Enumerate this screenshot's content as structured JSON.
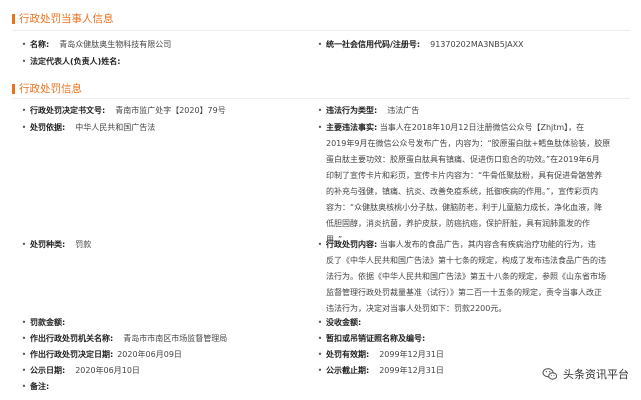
{
  "party_section": {
    "title": "行政处罚当事人信息"
  },
  "party": {
    "name_label": "名称:",
    "name_value": "青岛众健肽奥生物科技有限公司",
    "credit_code_label": "统一社会信用代码/注册号:",
    "credit_code_value": "91370202MA3NB5JAXX",
    "legal_rep_label": "法定代表人(负责人)姓名:",
    "legal_rep_value": ""
  },
  "penalty_section": {
    "title": "行政处罚信息"
  },
  "penalty": {
    "decision_no_label": "行政处罚决定书文号:",
    "decision_no_value": "青南市监广处字【2020】79号",
    "violation_type_label": "违法行为类型:",
    "violation_type_value": "违法广告",
    "basis_label": "处罚依据:",
    "basis_value": "中华人民共和国广告法",
    "main_facts_label": "主要违法事实:",
    "main_facts_lines": [
      "当事人在2018年10月12日注册微信公众号【Zhjtm】，在",
      "2019年9月在微信公众号发布广告，内容为：“胶原蛋白肽+鳕鱼肽体验装，胶原",
      "蛋白肽主要功效：胶原蛋白肽具有镇痛、促进伤口愈合的功效。”在2019年6月",
      "印制了宣传卡片和彩页，宣传卡片内容为：“牛骨低聚肽粉，具有促进骨骼营养",
      "的补充与强健，镇痛、抗炎、改善免疫系统，抵御疾病的作用。”，宣传彩页内",
      "容为：“众健肽奥核桃小分子肽，健脑防老，利于儿童脑力成长，净化血液，降",
      "低胆固醇，消炎抗菌，养护皮肤，防癌抗癌，保护肝脏，具有润肺熏发的作",
      "用。”"
    ],
    "category_label": "处罚种类:",
    "category_value": "罚款",
    "content_label": "行政处罚内容:",
    "content_lines": [
      "当事人发布的食品广告，其内容含有疾病治疗功能的行为，违",
      "反了《中华人民共和国广告法》第十七条的规定，构成了发布违法食品广告的违",
      "法行为。依据《中华人民共和国广告法》第五十八条的规定，参照《山东省市场",
      "监督管理行政处罚裁量基准（试行）》第二百一十五条的规定，责令当事人改正",
      "违法行为，决定对当事人处罚如下：罚款2200元。"
    ],
    "fine_label": "罚款金额:",
    "fine_value": "",
    "confiscation_label": "没收金额:",
    "confiscation_value": "",
    "authority_label": "作出行政处罚机关名称:",
    "authority_value": "青岛市市南区市场监督管理局",
    "license_label": "暂扣或吊销证照名称及编号:",
    "license_value": "",
    "decision_date_label": "作出行政处罚决定日期:",
    "decision_date_value": "2020年06月09日",
    "valid_until_label": "处罚有效期:",
    "valid_until_value": "2099年12月31日",
    "publish_date_label": "公示日期:",
    "publish_date_value": "2020年06月10日",
    "publish_end_label": "公示截止期:",
    "publish_end_value": "2099年12月31日",
    "remarks_label": "备注:",
    "remarks_value": ""
  },
  "watermark": {
    "text": "头条资讯平台",
    "icon": "wechat-icon"
  },
  "colors": {
    "accent": "#e8731f",
    "text": "#333333",
    "label": "#222222"
  }
}
